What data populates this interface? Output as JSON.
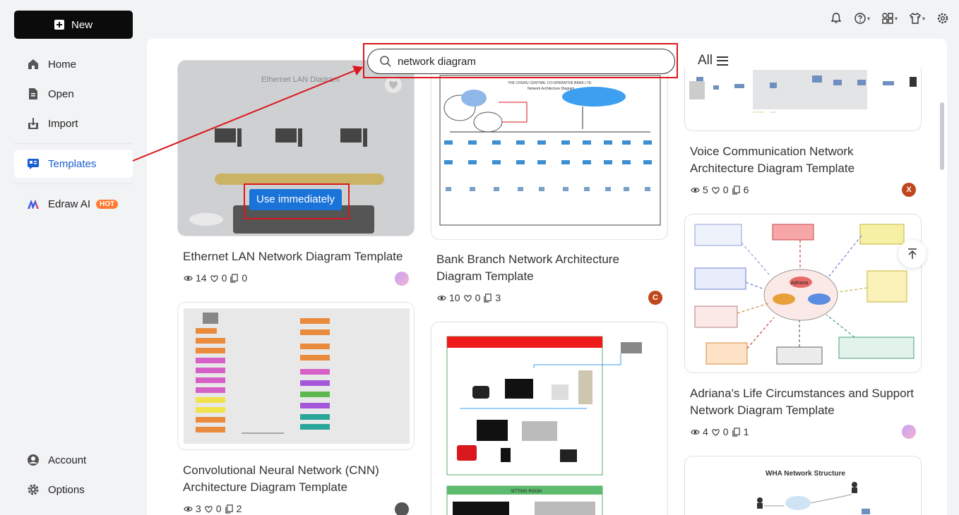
{
  "sidebar": {
    "new_label": "New",
    "items": [
      {
        "label": "Home",
        "icon": "home-icon"
      },
      {
        "label": "Open",
        "icon": "file-icon"
      },
      {
        "label": "Import",
        "icon": "import-icon"
      },
      {
        "label": "Templates",
        "icon": "templates-icon",
        "active": true
      },
      {
        "label": "Edraw AI",
        "icon": "edraw-ai-icon",
        "badge": "HOT"
      }
    ],
    "bottom": [
      {
        "label": "Account",
        "icon": "user-icon"
      },
      {
        "label": "Options",
        "icon": "gear-icon"
      }
    ]
  },
  "top_icons": [
    "bell-icon",
    "help-icon",
    "apps-icon",
    "shirt-icon",
    "settings-icon"
  ],
  "search": {
    "value": "network diagram",
    "placeholder": ""
  },
  "filter": {
    "label": "All"
  },
  "use_button_label": "Use immediately",
  "colors": {
    "accent": "#1a5fd1",
    "button": "#1a73d8",
    "highlight": "#d9171d",
    "hot": "#ff7a33"
  },
  "cards": [
    {
      "title_line1": "Ethernet LAN Network Diagram Template",
      "title_line2": "",
      "views": "14",
      "likes": "0",
      "copies": "0"
    },
    {
      "title_line1": "Convolutional Neural Network (CNN)",
      "title_line2": "Architecture Diagram Template",
      "views": "3",
      "likes": "0",
      "copies": "2"
    },
    {
      "title_line1": "Bank Branch Network Architecture",
      "title_line2": "Diagram Template",
      "views": "10",
      "likes": "0",
      "copies": "3",
      "avatar": "C"
    },
    {
      "title_line1": "Voice Communication Network",
      "title_line2": "Architecture Diagram Template",
      "views": "5",
      "likes": "0",
      "copies": "6",
      "avatar": "X"
    },
    {
      "title_line1": "Adriana's Life Circumstances and Support",
      "title_line2": "Network Diagram Template",
      "views": "4",
      "likes": "0",
      "copies": "1"
    },
    {
      "title_line1": "",
      "title_line2": "",
      "views": "",
      "likes": "",
      "copies": ""
    }
  ],
  "thumb_texts": {
    "ethernet_title": "Ethernet LAN Diagram",
    "bank_header": "THE CHURU CENTRAL CO-OPERATIVE BANK LTD.",
    "bank_sub": "Network Architecture Diagram",
    "wha_title": "WHA Network Structure",
    "adriana_center": "Adriana",
    "sitting_room": "SITTING ROOM"
  }
}
